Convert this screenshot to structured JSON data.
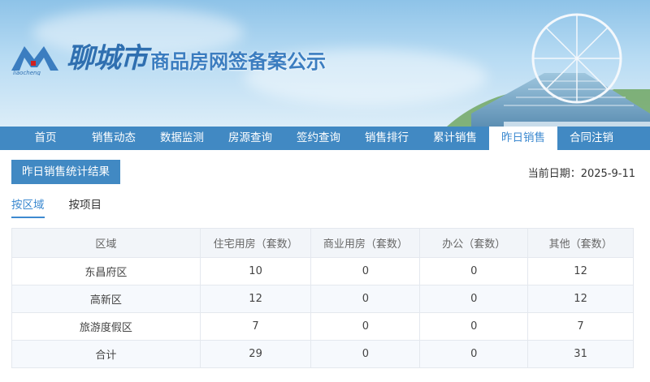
{
  "header": {
    "logo_text": "liaocheng",
    "city": "聊城市",
    "title": "商品房网签备案公示"
  },
  "nav": [
    {
      "label": "首页"
    },
    {
      "label": "销售动态"
    },
    {
      "label": "数据监测"
    },
    {
      "label": "房源查询"
    },
    {
      "label": "签约查询"
    },
    {
      "label": "销售排行"
    },
    {
      "label": "累计销售"
    },
    {
      "label": "昨日销售",
      "active": true
    },
    {
      "label": "合同注销"
    }
  ],
  "toolbar": {
    "result_label": "昨日销售统计结果",
    "date_label": "当前日期：",
    "date_value": "2025-9-11"
  },
  "tabs": [
    {
      "label": "按区域",
      "active": true
    },
    {
      "label": "按项目"
    }
  ],
  "table": {
    "headers": [
      "区域",
      "住宅用房（套数）",
      "商业用房（套数）",
      "办公（套数）",
      "其他（套数）"
    ],
    "rows": [
      [
        "东昌府区",
        "10",
        "0",
        "0",
        "12"
      ],
      [
        "高新区",
        "12",
        "0",
        "0",
        "12"
      ],
      [
        "旅游度假区",
        "7",
        "0",
        "0",
        "7"
      ],
      [
        "合计",
        "29",
        "0",
        "0",
        "31"
      ]
    ]
  },
  "colors": {
    "accent": "#4189c3",
    "active_text": "#3d8ad0"
  }
}
